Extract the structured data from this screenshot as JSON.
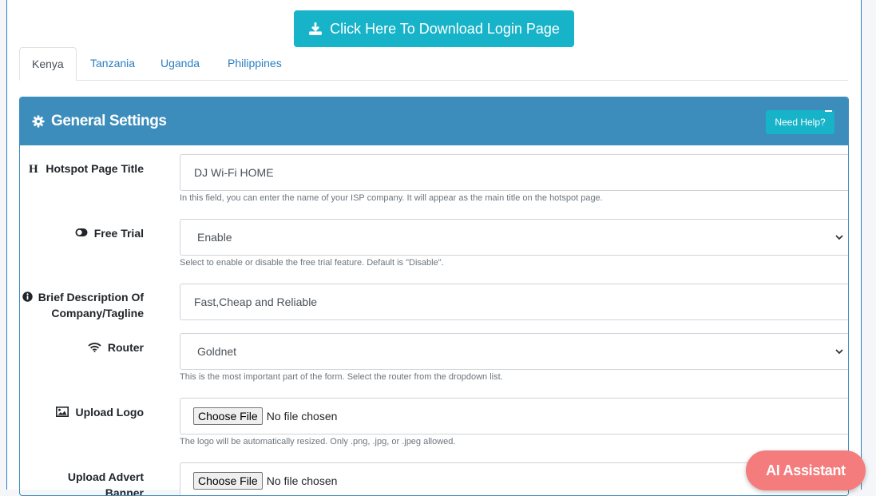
{
  "download_button": {
    "label": "Click Here To Download Login Page",
    "icon": "download-icon"
  },
  "tabs": [
    {
      "label": "Kenya",
      "active": true
    },
    {
      "label": "Tanzania",
      "active": false
    },
    {
      "label": "Uganda",
      "active": false
    },
    {
      "label": "Philippines",
      "active": false
    }
  ],
  "card": {
    "title": "General Settings",
    "title_icon": "gear-icon",
    "help_label": "Need Help?",
    "header_color": "#3c8dbc"
  },
  "fields": {
    "title": {
      "label": "Hotspot Page Title",
      "value": "DJ Wi-Fi HOME",
      "help": "In this field, you can enter the name of your ISP company. It will appear as the main title on the hotspot page."
    },
    "free_trial": {
      "label": "Free Trial",
      "value": "Enable",
      "help": "Select to enable or disable the free trial feature. Default is \"Disable\"."
    },
    "description": {
      "label_line1": "Brief Description Of",
      "label_line2": "Company/Tagline",
      "value": "Fast,Cheap and Reliable"
    },
    "router": {
      "label": "Router",
      "value": "Goldnet",
      "help": "This is the most important part of the form. Select the router from the dropdown list."
    },
    "logo": {
      "label": "Upload Logo",
      "button": "Choose File",
      "status": "No file chosen",
      "help": "The logo will be automatically resized. Only .png, .jpg, or .jpeg allowed."
    },
    "advert": {
      "label_line1": "Upload Advert",
      "label_line2": "Banner",
      "button": "Choose File",
      "status": "No file chosen"
    }
  },
  "ai_assistant": {
    "label": "AI Assistant",
    "color": "#f47c7c"
  }
}
